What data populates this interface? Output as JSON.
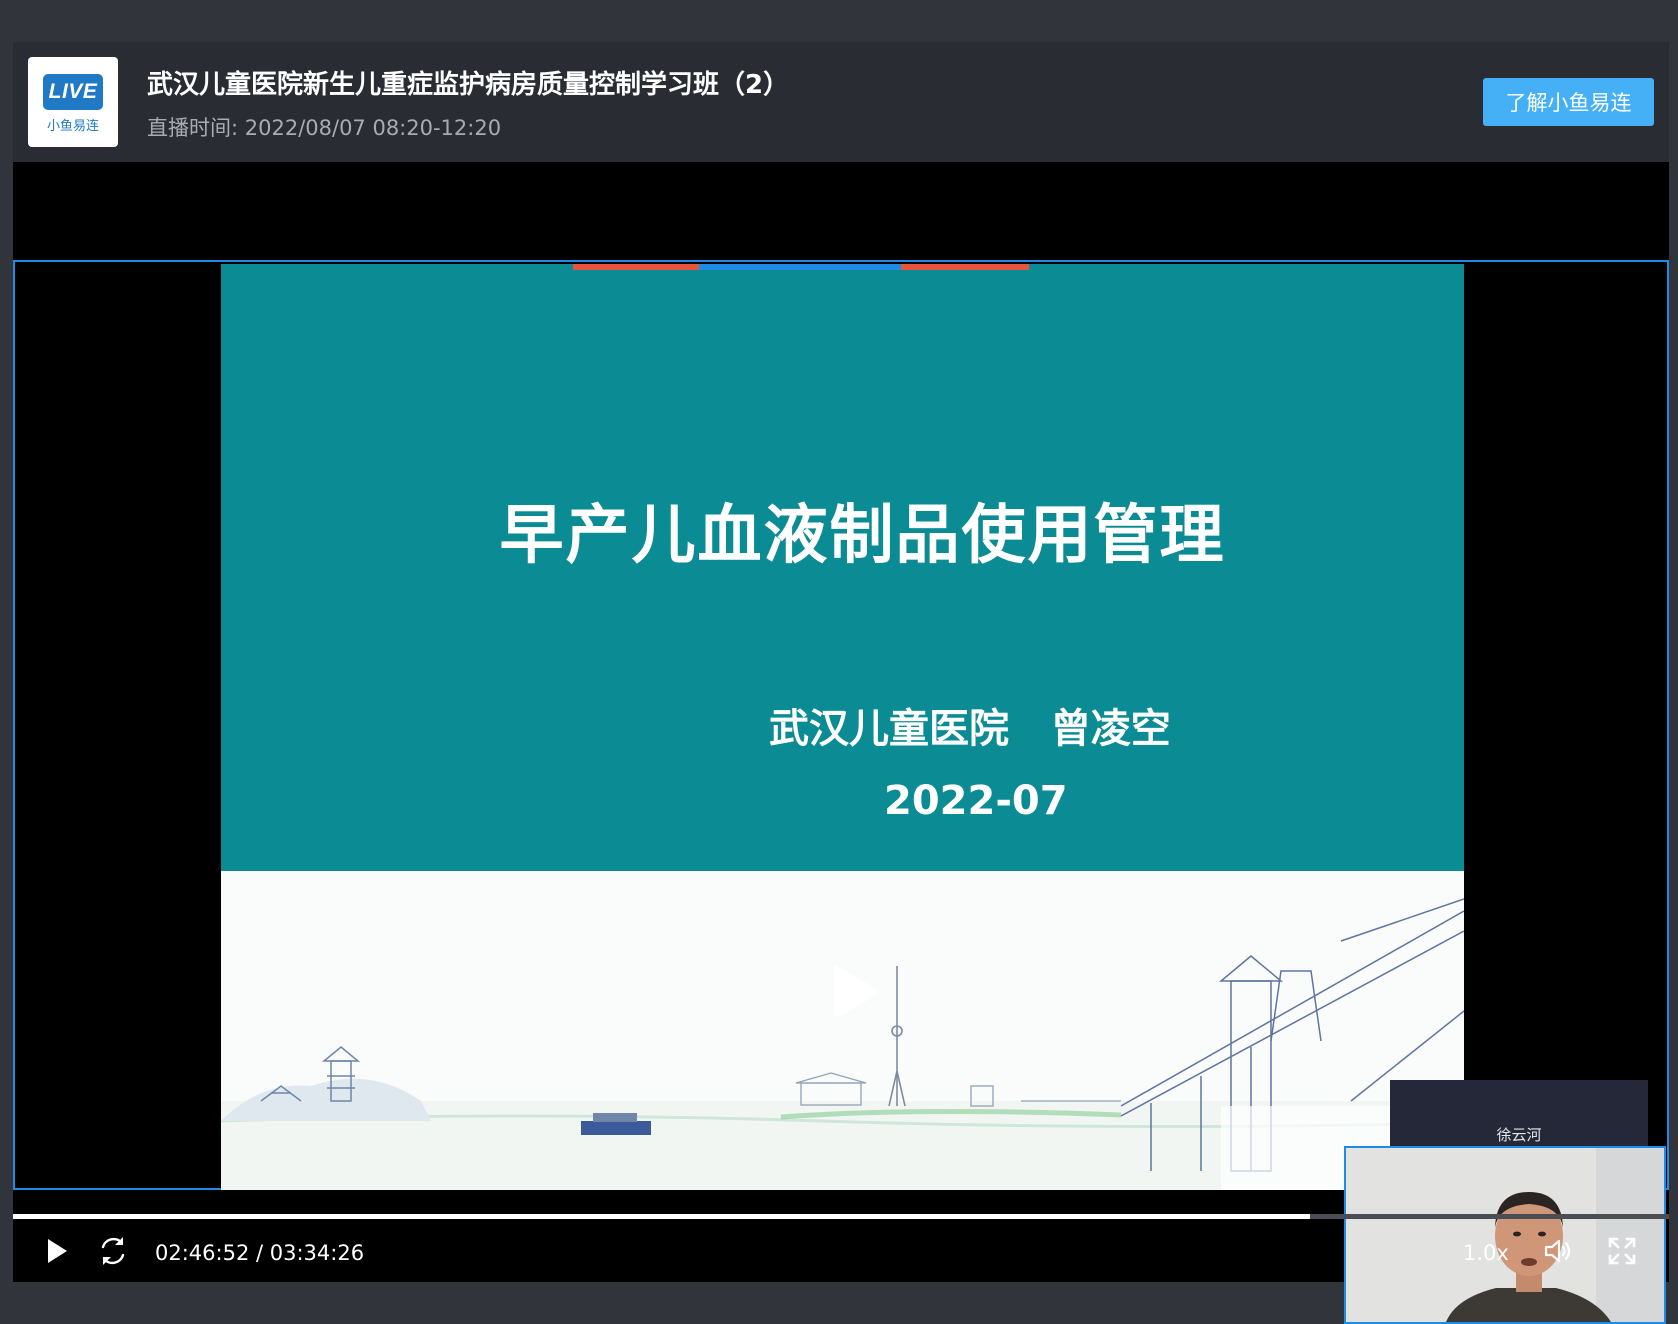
{
  "header": {
    "logo": {
      "badge": "LIVE",
      "brand": "小鱼易连"
    },
    "title": "武汉儿童医院新生儿重症监护病房质量控制学习班（2）",
    "subtitle": "直播时间: 2022/08/07 08:20-12:20",
    "learn_more_button": "了解小鱼易连"
  },
  "slide": {
    "title": "早产儿血液制品使用管理",
    "author": "武汉儿童医院   曾凌空",
    "date": "2022-07",
    "colors": {
      "teal": "#0b8b93",
      "stripe_red": "#e8553e",
      "stripe_blue": "#1e8ce4"
    }
  },
  "participant": {
    "name": "徐云河"
  },
  "controls": {
    "time": "02:46:52 / 03:34:26",
    "progress": 0.783,
    "speed": "1.0x",
    "icons": [
      "play-icon",
      "replay-icon",
      "volume-icon",
      "fullscreen-icon"
    ]
  },
  "colors": {
    "accent": "#45b0f5",
    "header_bg": "#2a2c34",
    "frame_border": "#1e8ce4"
  }
}
